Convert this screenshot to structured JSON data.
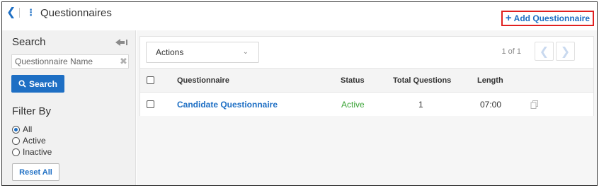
{
  "header": {
    "title": "Questionnaires",
    "add_button": "Add Questionnaire"
  },
  "sidebar": {
    "search_label": "Search",
    "search_placeholder": "Questionnaire Name",
    "search_button": "Search",
    "filter_label": "Filter By",
    "filters": [
      {
        "label": "All",
        "selected": true
      },
      {
        "label": "Active",
        "selected": false
      },
      {
        "label": "Inactive",
        "selected": false
      }
    ],
    "reset_button": "Reset All"
  },
  "toolbar": {
    "actions_label": "Actions",
    "pagination": "1 of 1"
  },
  "table": {
    "columns": [
      "Questionnaire",
      "Status",
      "Total Questions",
      "Length"
    ],
    "rows": [
      {
        "questionnaire": "Candidate Questionnaire",
        "status": "Active",
        "total_questions": "1",
        "length": "07:00"
      }
    ]
  },
  "colors": {
    "accent": "#1e6fc4",
    "active_status": "#3aa335",
    "highlight_border": "#e02020"
  },
  "icons": [
    "back-chevron-icon",
    "kebab-icon",
    "plus-icon",
    "collapse-arrow-icon",
    "clear-icon",
    "search-icon",
    "chevron-down-icon",
    "prev-page-icon",
    "next-page-icon",
    "copy-icon"
  ]
}
